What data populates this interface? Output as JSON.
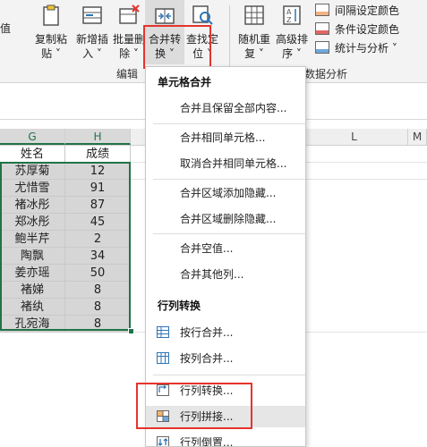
{
  "ribbon": {
    "partial_left": "值",
    "buttons": {
      "copy_paste": [
        "复制粘",
        "贴 ˅"
      ],
      "insert": [
        "新增插",
        "入 ˅"
      ],
      "batch_delete": [
        "批量删",
        "除 ˅"
      ],
      "merge": [
        "合并转",
        "换 ˅"
      ],
      "find": [
        "查找定",
        "位 ˅"
      ],
      "random": [
        "随机重",
        "复 ˅"
      ],
      "sort": [
        "高级排",
        "序 ˅"
      ]
    },
    "small_buttons": [
      "间隔设定颜色",
      "条件设定颜色",
      "统计与分析 ˅"
    ],
    "groups": [
      "编辑",
      "数据分析"
    ],
    "accent": "#e5342c"
  },
  "sheet": {
    "columns": [
      "G",
      "H",
      "L",
      "M"
    ],
    "header": [
      "姓名",
      "成绩"
    ],
    "rows": [
      [
        "苏厚菊",
        "12"
      ],
      [
        "尤惜雪",
        "91"
      ],
      [
        "褚冰彤",
        "87"
      ],
      [
        "郑冰彤",
        "45"
      ],
      [
        "鲍半芹",
        "2"
      ],
      [
        "陶飘",
        "34"
      ],
      [
        "姜亦瑶",
        "50"
      ],
      [
        "褚娣",
        "8"
      ],
      [
        "褚纨",
        "8"
      ],
      [
        "孔宛海",
        "8"
      ]
    ],
    "selection_color": "#217346"
  },
  "menu": {
    "section1": "单元格合并",
    "section2": "行列转换",
    "items": [
      "合并且保留全部内容...",
      "合并相同单元格...",
      "取消合并相同单元格...",
      "合并区域添加隐藏...",
      "合并区域删除隐藏...",
      "合并空值...",
      "合并其他列...",
      "按行合并...",
      "按列合并...",
      "行列转换...",
      "行列拼接...",
      "行列倒置..."
    ]
  }
}
